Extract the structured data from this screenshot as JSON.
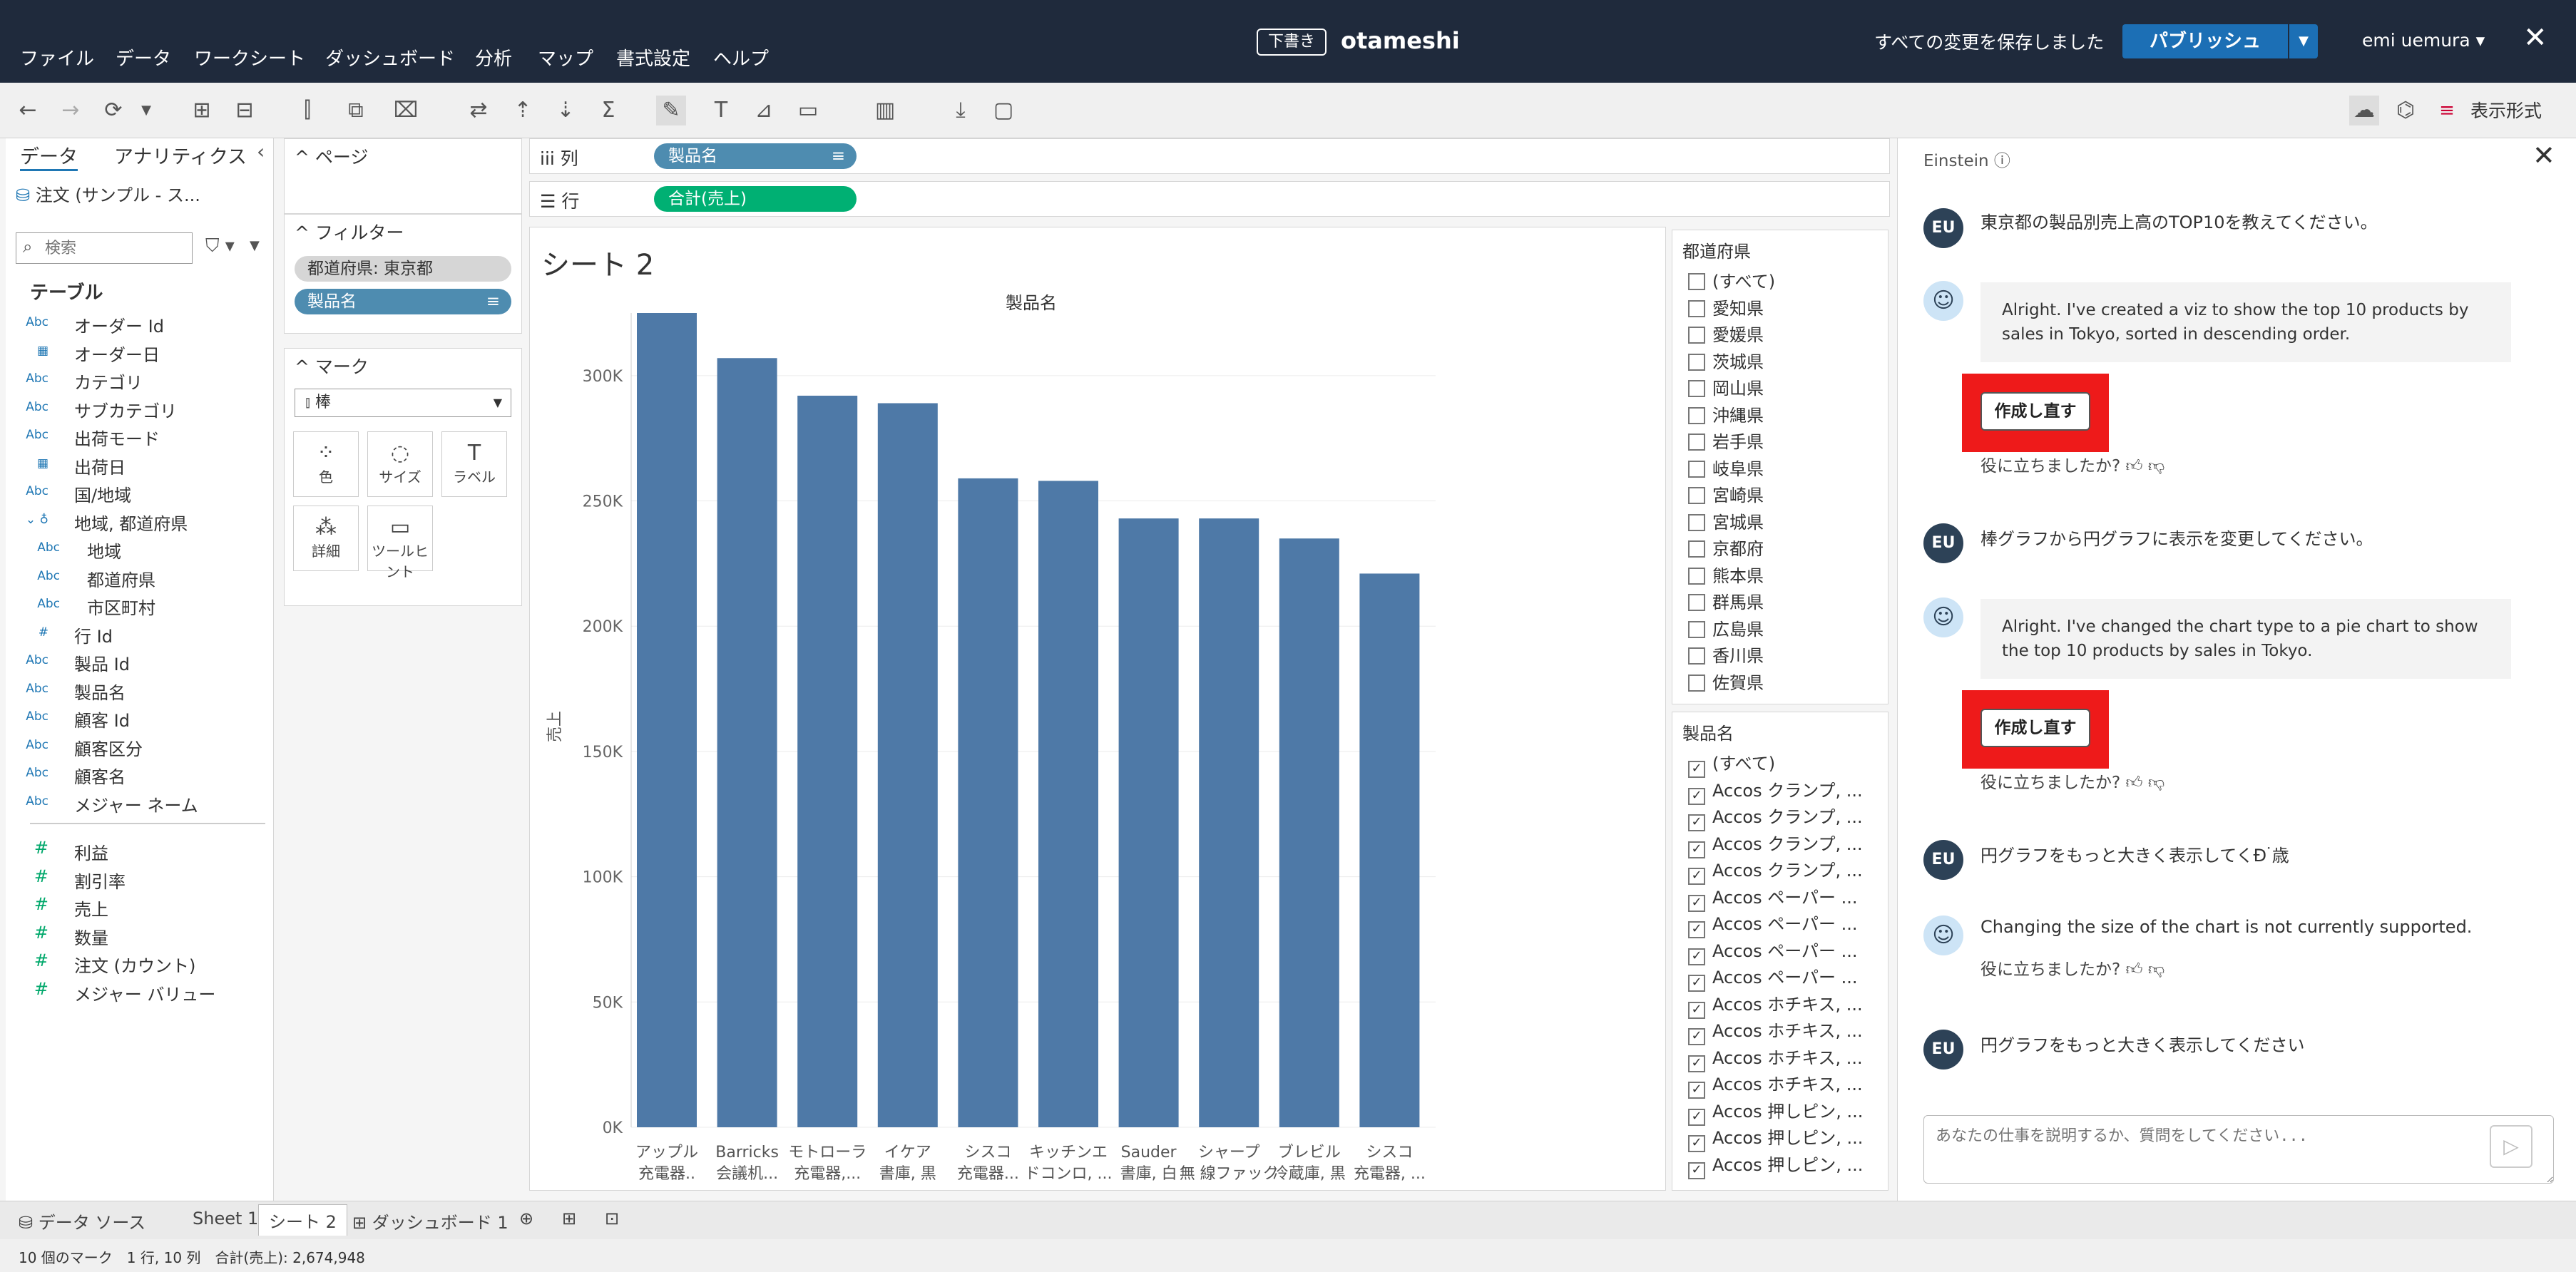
{
  "menu": [
    "ファイル",
    "データ",
    "ワークシート",
    "ダッシュボード",
    "分析",
    "マップ",
    "書式設定",
    "ヘルプ"
  ],
  "doc": {
    "badge": "下書き",
    "title": "otameshi"
  },
  "status_saved": "すべての変更を保存しました",
  "publish_label": "パブリッシュ",
  "user": "emi uemura ▾",
  "toolbar": {
    "show_me": "表示形式"
  },
  "left_pane": {
    "tabs": [
      "データ",
      "アナリティクス"
    ],
    "datasource": "注文 (サンプル - ス...",
    "search_placeholder": "検索",
    "table_header": "テーブル",
    "fields": [
      {
        "type": "Abc",
        "label": "オーダー Id",
        "kind": "dim",
        "indent": 0
      },
      {
        "type": "▦",
        "label": "オーダー日",
        "kind": "dim",
        "indent": 0
      },
      {
        "type": "Abc",
        "label": "カテゴリ",
        "kind": "dim",
        "indent": 0
      },
      {
        "type": "Abc",
        "label": "サブカテゴリ",
        "kind": "dim",
        "indent": 0
      },
      {
        "type": "Abc",
        "label": "出荷モード",
        "kind": "dim",
        "indent": 0
      },
      {
        "type": "▦",
        "label": "出荷日",
        "kind": "dim",
        "indent": 0
      },
      {
        "type": "Abc",
        "label": "国/地域",
        "kind": "dim",
        "indent": 0
      },
      {
        "type": "⌄ ♁",
        "label": "地域, 都道府県",
        "kind": "dim",
        "indent": 0
      },
      {
        "type": "Abc",
        "label": "地域",
        "kind": "dim",
        "indent": 1
      },
      {
        "type": "Abc",
        "label": "都道府県",
        "kind": "dim",
        "indent": 1
      },
      {
        "type": "Abc",
        "label": "市区町村",
        "kind": "dim",
        "indent": 1
      },
      {
        "type": "#",
        "label": "行 Id",
        "kind": "dim",
        "indent": 0
      },
      {
        "type": "Abc",
        "label": "製品 Id",
        "kind": "dim",
        "indent": 0
      },
      {
        "type": "Abc",
        "label": "製品名",
        "kind": "dim",
        "indent": 0
      },
      {
        "type": "Abc",
        "label": "顧客 Id",
        "kind": "dim",
        "indent": 0
      },
      {
        "type": "Abc",
        "label": "顧客区分",
        "kind": "dim",
        "indent": 0
      },
      {
        "type": "Abc",
        "label": "顧客名",
        "kind": "dim",
        "indent": 0
      },
      {
        "type": "Abc",
        "label": "メジャー ネーム",
        "kind": "dim",
        "indent": 0
      },
      {
        "type": "#",
        "label": "利益",
        "kind": "meas",
        "indent": 0
      },
      {
        "type": "#",
        "label": "割引率",
        "kind": "meas",
        "indent": 0
      },
      {
        "type": "#",
        "label": "売上",
        "kind": "meas",
        "indent": 0
      },
      {
        "type": "#",
        "label": "数量",
        "kind": "meas",
        "indent": 0
      },
      {
        "type": "#",
        "label": "注文 (カウント)",
        "kind": "meas",
        "indent": 0
      },
      {
        "type": "#",
        "label": "メジャー バリュー",
        "kind": "meas",
        "indent": 0
      }
    ]
  },
  "cards": {
    "pages_title": "^ ページ",
    "filters_title": "^ フィルター",
    "filter_pills": [
      "都道府県: 東京都",
      "製品名"
    ],
    "marks_title": "^ マーク",
    "mark_type": "棒",
    "mark_buttons": [
      {
        "icon": "⁘",
        "label": "色"
      },
      {
        "icon": "◌",
        "label": "サイズ"
      },
      {
        "icon": "T",
        "label": "ラベル"
      },
      {
        "icon": "⁂",
        "label": "詳細"
      },
      {
        "icon": "▭",
        "label": "ツールヒント"
      }
    ]
  },
  "shelves": {
    "columns_label": "iii 列",
    "columns_pill": "製品名",
    "rows_label": "☰ 行",
    "rows_pill": "合計(売上)"
  },
  "sheet_title": "シート 2",
  "chart_data": {
    "type": "bar",
    "title": "製品名",
    "ylabel": "売上",
    "ylim": [
      0,
      325000
    ],
    "yticks": [
      "0K",
      "50K",
      "100K",
      "150K",
      "200K",
      "250K",
      "300K"
    ],
    "categories": [
      "アップル 充電器..",
      "Barricks 会議机...",
      "モトローラ 充電器,...",
      "イケア 書庫, 黒",
      "シスコ 充電器...",
      "キッチンエ ドコンロ, ...",
      "Sauder 書庫, 白",
      "シャープ 無 線ファック",
      "ブレビル 冷蔵庫, 黒",
      "シスコ 充電器, ..."
    ],
    "values": [
      325000,
      307000,
      292000,
      289000,
      259000,
      258000,
      243000,
      243000,
      235000,
      221000
    ],
    "color": "#4e79a7"
  },
  "filters_right": {
    "pref_title": "都道府県",
    "pref_items": [
      "(すべて)",
      "愛知県",
      "愛媛県",
      "茨城県",
      "岡山県",
      "沖縄県",
      "岩手県",
      "岐阜県",
      "宮崎県",
      "宮城県",
      "京都府",
      "熊本県",
      "群馬県",
      "広島県",
      "香川県",
      "佐賀県"
    ],
    "prod_title": "製品名",
    "prod_items": [
      "(すべて)",
      "Accos クランプ, ...",
      "Accos クランプ, ...",
      "Accos クランプ, ...",
      "Accos クランプ, ...",
      "Accos ペーパー ...",
      "Accos ペーパー ...",
      "Accos ペーパー ...",
      "Accos ペーパー ...",
      "Accos ホチキス, ...",
      "Accos ホチキス, ...",
      "Accos ホチキス, ...",
      "Accos ホチキス, ...",
      "Accos 押しピン, ...",
      "Accos 押しピン, ...",
      "Accos 押しピン, ..."
    ]
  },
  "einstein": {
    "title": "Einstein ⓘ",
    "user_initials": "EU",
    "messages": [
      {
        "role": "user",
        "text": "東京都の製品別売上高のTOP10を教えてください。"
      },
      {
        "role": "bot",
        "text": "Alright. I've created a viz to show the top 10 products by sales in Tokyo, sorted in descending order."
      },
      {
        "role": "user",
        "text": "棒グラフから円グラフに表示を変更してください。"
      },
      {
        "role": "bot",
        "text": "Alright. I've changed the chart type to a pie chart to show the top 10 products by sales in Tokyo."
      },
      {
        "role": "user",
        "text": "円グラフをもっと大きく表示してくÐ۬ 歳"
      },
      {
        "role": "bot",
        "text": "Changing the size of the chart is not currently supported."
      },
      {
        "role": "user",
        "text": "円グラフをもっと大きく表示してください"
      }
    ],
    "redo_label": "作成し直す",
    "feedback_label": "役に立ちましたか?",
    "input_placeholder": "あなたの仕事を説明するか、質問をしてください..."
  },
  "bottom_tabs": [
    "データ ソース",
    "Sheet 1",
    "シート 2",
    "ダッシュボード 1"
  ],
  "status_bar": "10 個のマーク　1 行, 10 列　合計(売上): 2,674,948"
}
